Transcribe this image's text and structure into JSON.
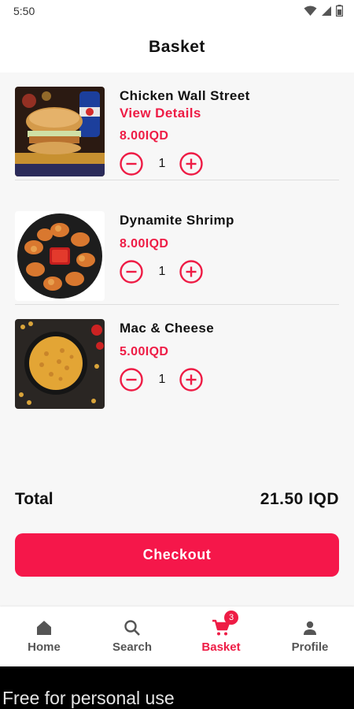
{
  "status_bar": {
    "time": "5:50",
    "icons": [
      "wifi-icon",
      "signal-icon",
      "battery-icon"
    ]
  },
  "header": {
    "title": "Basket"
  },
  "items": [
    {
      "name": "Chicken Wall Street",
      "link_label": "View Details",
      "price": "8.00IQD",
      "quantity": "1",
      "image": "burger-with-pepsi-photo"
    },
    {
      "name": "Dynamite Shrimp",
      "price": "8.00IQD",
      "quantity": "1",
      "image": "fried-shrimp-plate-photo"
    },
    {
      "name": "Mac & Cheese",
      "price": "5.00IQD",
      "quantity": "1",
      "image": "mac-and-cheese-bowl-photo"
    }
  ],
  "summary": {
    "total_label": "Total",
    "total_value": "21.50 IQD"
  },
  "checkout": {
    "label": "Checkout"
  },
  "nav": {
    "items": [
      {
        "label": "Home",
        "icon": "home-icon",
        "active": false
      },
      {
        "label": "Search",
        "icon": "search-icon",
        "active": false
      },
      {
        "label": "Basket",
        "icon": "cart-icon",
        "active": true,
        "badge": "3"
      },
      {
        "label": "Profile",
        "icon": "person-icon",
        "active": false
      }
    ]
  },
  "watermark": {
    "text": "Free for personal use"
  },
  "colors": {
    "accent": "#ee1c45",
    "button": "#f5174a",
    "background": "#f7f7f7",
    "nav_inactive": "#555555"
  }
}
